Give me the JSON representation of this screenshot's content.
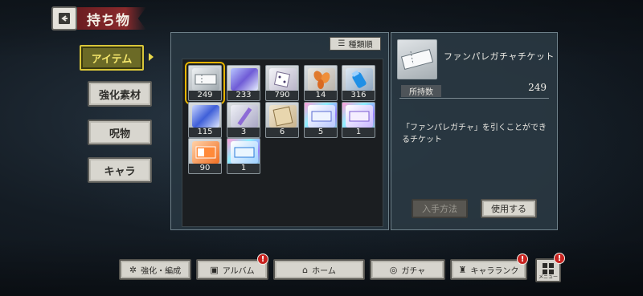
{
  "header": {
    "title": "持ち物",
    "back_icon": "back-arrow-icon"
  },
  "side_tabs": [
    {
      "label": "アイテム",
      "active": true
    },
    {
      "label": "強化素材",
      "active": false
    },
    {
      "label": "呪物",
      "active": false
    },
    {
      "label": "キャラ",
      "active": false
    }
  ],
  "inventory": {
    "sort_label": "種類順",
    "items": [
      {
        "qty": "249",
        "icon": "ticket-icon",
        "selected": true
      },
      {
        "qty": "233",
        "icon": "crystal-cards-icon"
      },
      {
        "qty": "790",
        "icon": "dice-icon"
      },
      {
        "qty": "14",
        "icon": "leaves-icon"
      },
      {
        "qty": "316",
        "icon": "blue-bottle-icon"
      },
      {
        "qty": "115",
        "icon": "blue-shards-icon"
      },
      {
        "qty": "3",
        "icon": "crystal-pen-icon"
      },
      {
        "qty": "6",
        "icon": "scroll-map-icon"
      },
      {
        "qty": "5",
        "icon": "holo-ticket-icon"
      },
      {
        "qty": "1",
        "icon": "holo-ticket-icon"
      },
      {
        "qty": "90",
        "icon": "orange-card-icon"
      },
      {
        "qty": "1",
        "icon": "holo-ticket-blue-icon"
      }
    ]
  },
  "detail": {
    "name": "ファンパレガチャチケット",
    "owned_label": "所持数",
    "owned_value": "249",
    "description": "「ファンパレガチャ」を引くことができるチケット",
    "howto_label": "入手方法",
    "use_label": "使用する"
  },
  "nav": {
    "enhance_label": "強化・編成",
    "album_label": "アルバム",
    "home_label": "ホーム",
    "gacha_label": "ガチャ",
    "rank_label": "キャラランク",
    "menu_label": "メニュー",
    "badge": "!"
  },
  "colors": {
    "accent": "#e6b400",
    "title_banner": "#8a2a2c",
    "badge": "#c8221f"
  }
}
